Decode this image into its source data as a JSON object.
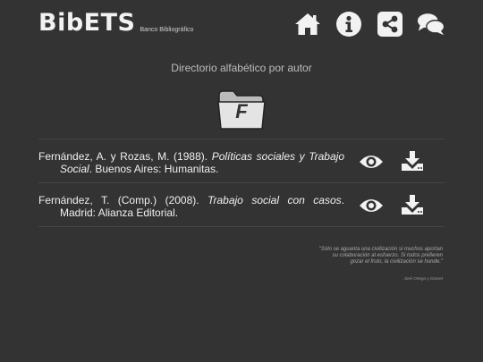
{
  "header": {
    "logo": "BibETS",
    "subtitle": "Banco Bibliográfico",
    "nav": [
      "home-icon",
      "info-icon",
      "share-icon",
      "comments-icon"
    ]
  },
  "main": {
    "title": "Directorio alfabético por autor",
    "folder_letter": "F",
    "entries": [
      {
        "before": "Fernández, A. y Rozas, M. (1988). ",
        "title": "Políticas sociales y Trabajo Social",
        "after": ". Buenos Aires: Humanitas."
      },
      {
        "before": "Fernández, T. (Comp.) (2008). ",
        "title": "Trabajo social con casos",
        "after": ". Madrid: Alianza Editorial."
      }
    ]
  },
  "quote": {
    "text": "\"Sólo se aguanta una civilización si muchos aportan su colaboración al esfuerzo. Si todos prefieren gozar el fruto, la civilización se hunde.\"",
    "author": "José Ortega y Gasset"
  },
  "colors": {
    "background": "#333333",
    "text": "#f0f0f0",
    "icon": "#f2f2f2"
  }
}
